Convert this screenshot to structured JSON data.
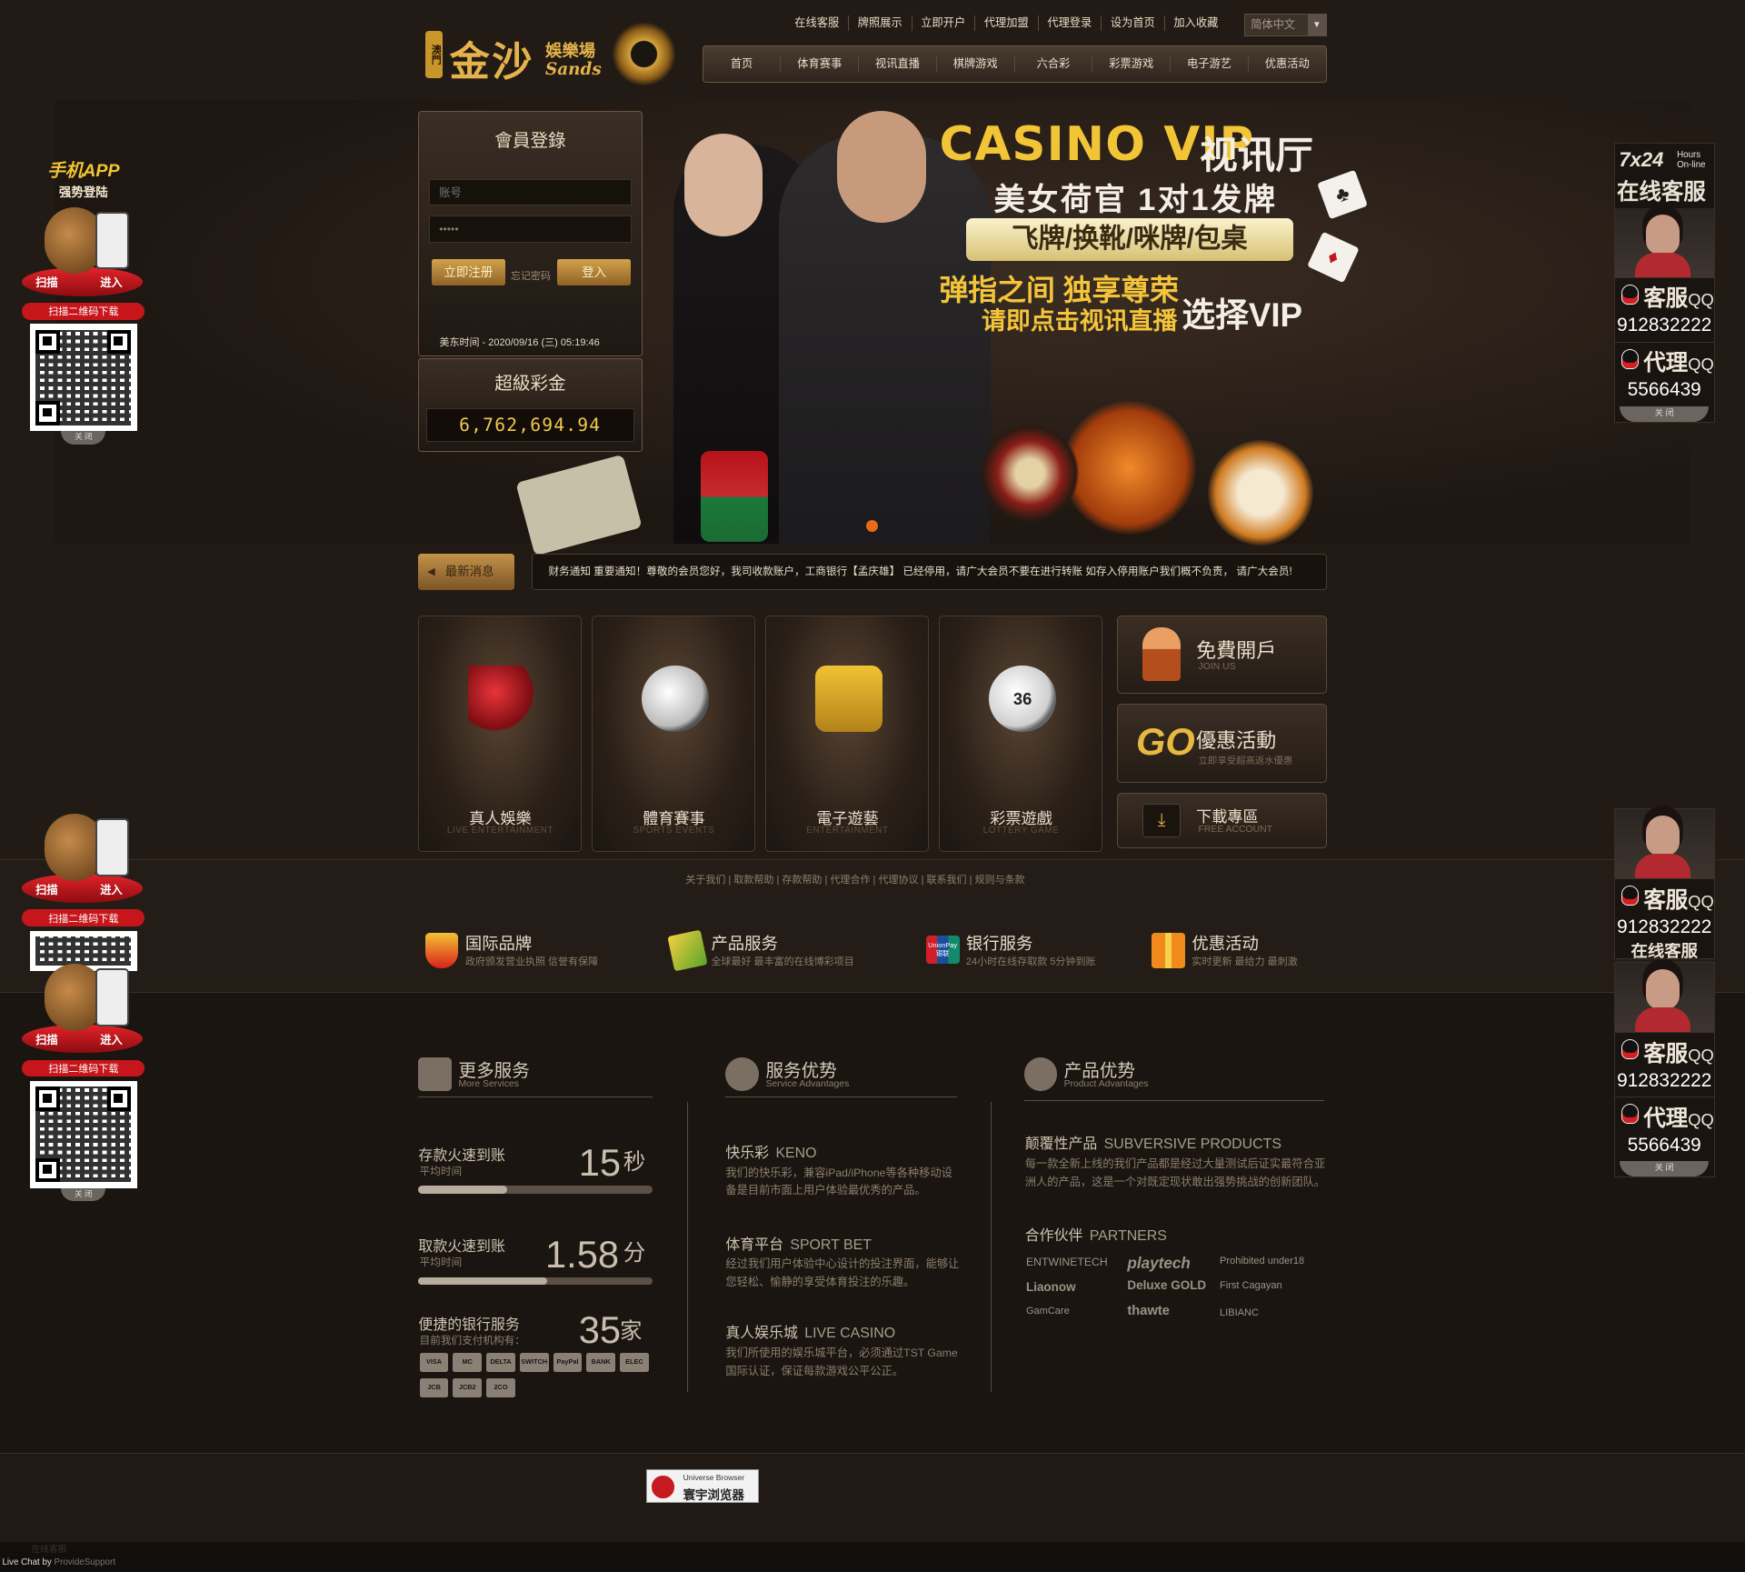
{
  "top_links": [
    "在线客服",
    "牌照展示",
    "立即开户",
    "代理加盟",
    "代理登录",
    "设为首页",
    "加入收藏"
  ],
  "language": {
    "selected": "简体中文"
  },
  "nav": [
    "首页",
    "体育赛事",
    "视讯直播",
    "棋牌游戏",
    "六合彩",
    "彩票游戏",
    "电子游艺",
    "优惠活动"
  ],
  "logo": {
    "badge": "澳門",
    "name": "金沙",
    "suffix": "娛樂場",
    "en": "Sands"
  },
  "banner": {
    "title_en": "CASINO VIP",
    "title_cn": "视讯厅",
    "line1": "美女荷官 1对1发牌",
    "pill": "飞牌/换靴/咪牌/包桌",
    "line2": "弹指之间 独享尊荣",
    "line3": "请即点击视讯直播",
    "vip": "选择VIP"
  },
  "login": {
    "title": "會員登錄",
    "username_placeholder": "账号",
    "password_value": "•••••",
    "register": "立即注册",
    "forgot": "忘记密码",
    "login": "登入",
    "time": "美东时间 - 2020/09/16 (三) 05:19:46"
  },
  "jackpot": {
    "title": "超級彩金",
    "value": "6,762,694.94"
  },
  "news": {
    "label": "最新消息",
    "text": "财务通知 重要通知！尊敬的会员您好，我司收款账户，工商银行【孟庆雄】 已经停用，请广大会员不要在进行转账 如存入停用账户我们概不负责， 请广大会员!"
  },
  "games": [
    {
      "cn": "真人娛樂",
      "en": "LIVE ENTERTAINMENT",
      "icon": "dice-icon"
    },
    {
      "cn": "體育賽事",
      "en": "SPORTS EVENTS",
      "icon": "soccer-ball-icon"
    },
    {
      "cn": "電子遊藝",
      "en": "ENTERTAINMENT",
      "icon": "slot-machine-icon"
    },
    {
      "cn": "彩票遊戲",
      "en": "LOTTERY GAME",
      "icon": "lottery-ball-icon"
    }
  ],
  "lottery_ball_number": "36",
  "side_cards": [
    {
      "title": "免費開戶",
      "sub": "JOIN US"
    },
    {
      "title": "優惠活動",
      "sub": "立即享受超高返水優惠",
      "badge": "GO"
    },
    {
      "title": "下載專區",
      "sub": "FREE ACCOUNT"
    }
  ],
  "footer_links": "关于我们 | 取款帮助 | 存款帮助 | 代理合作 | 代理协议 | 联系我们 | 规则与条款",
  "features": [
    {
      "title": "国际品牌",
      "sub": "政府颁发营业执照 信誉有保障"
    },
    {
      "title": "产品服务",
      "sub": "全球最好 最丰富的在线博彩项目"
    },
    {
      "title": "银行服务",
      "sub": "24小时在线存取款 5分钟到账"
    },
    {
      "title": "优惠活动",
      "sub": "实时更新 最给力 最刺激"
    }
  ],
  "unionpay": {
    "l1": "UnionPay",
    "l2": "银联"
  },
  "columns": {
    "more": {
      "title": "更多服务",
      "sub": "More Services"
    },
    "adv": {
      "title": "服务优势",
      "sub": "Service Advantages"
    },
    "prod": {
      "title": "产品优势",
      "sub": "Product Advantages"
    }
  },
  "stats": [
    {
      "title": "存款火速到账",
      "sub": "平均时间",
      "value": "15",
      "unit": "秒",
      "progress": 0.38
    },
    {
      "title": "取款火速到账",
      "sub": "平均时间",
      "value": "1.58",
      "unit": "分",
      "progress": 0.55
    },
    {
      "title": "便捷的银行服务",
      "sub": "目前我们支付机构有：",
      "value": "35",
      "unit": "家"
    }
  ],
  "payments": [
    "VISA",
    "MC",
    "DELTA",
    "SWITCH",
    "PayPal",
    "BANK",
    "ELEC",
    "JCB",
    "JCB2",
    "2CO"
  ],
  "services": [
    {
      "cn": "快乐彩",
      "en": "KENO",
      "desc": "我们的快乐彩，兼容iPad/iPhone等各种移动设备是目前市面上用户体验最优秀的产品。"
    },
    {
      "cn": "体育平台",
      "en": "SPORT BET",
      "desc": "经过我们用户体验中心设计的投注界面，能够让您轻松、愉静的享受体育投注的乐趣。"
    },
    {
      "cn": "真人娱乐城",
      "en": "LIVE CASINO",
      "desc": "我们所使用的娱乐城平台，必须通过TST Game国际认证，保证每款游戏公平公正。"
    }
  ],
  "product": {
    "title_cn": "颠覆性产品",
    "title_en": "SUBVERSIVE PRODUCTS",
    "desc": "每一款全新上线的我们产品都是经过大量测试后证实最符合亚洲人的产品，这是一个对既定现状敢出强势挑战的创新团队。"
  },
  "partners": {
    "title_cn": "合作伙伴",
    "title_en": "PARTNERS",
    "items": [
      "ENTWINETECH",
      "playtech",
      "Prohibited under18",
      "Liaonow",
      "Deluxe GOLD",
      "First Cagayan",
      "GamCare",
      "thawte",
      "LIBIANC"
    ]
  },
  "left_float": {
    "title": "手机APP",
    "sub": "强势登陆",
    "scan": "扫描",
    "enter": "进入",
    "download": "扫描二维码下载",
    "close": "关 闭"
  },
  "right_float": {
    "h1": "7x24",
    "h1b": "Hours On-line",
    "h2": "在线客服",
    "kefu": "客服",
    "agent": "代理",
    "qq": "QQ",
    "kefu_num": "912832222",
    "agent_num": "5566439",
    "close": "关 闭"
  },
  "universe_browser": {
    "en": "Universe Browser",
    "cn": "寰宇浏览器"
  },
  "live_chat": {
    "label": "Live Chat",
    "by": "by",
    "provider": "ProvideSupport"
  },
  "faint_text": "在线客服"
}
